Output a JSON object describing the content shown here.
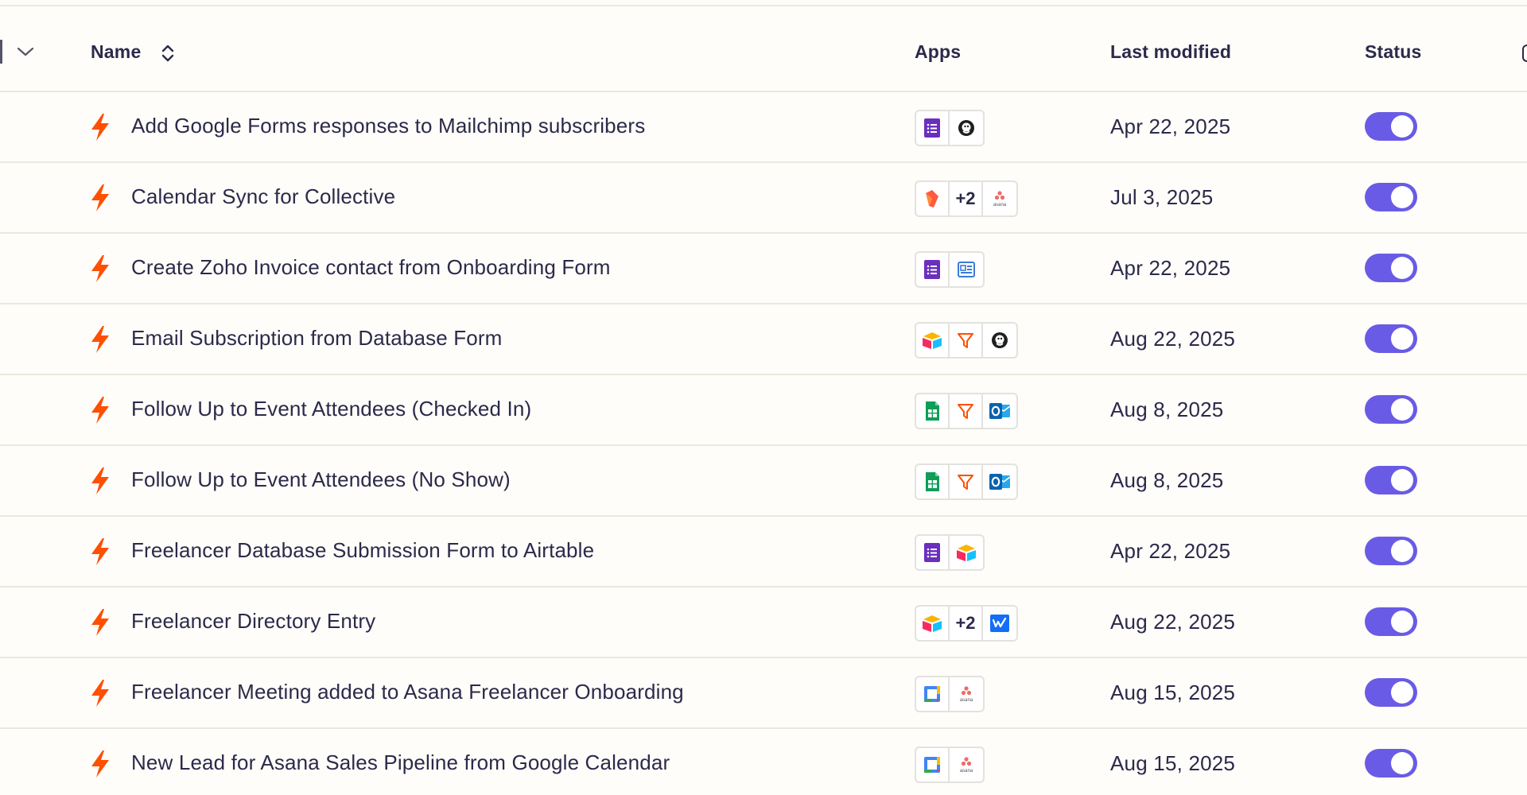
{
  "header": {
    "name_label": "Name",
    "apps_label": "Apps",
    "modified_label": "Last modified",
    "status_label": "Status"
  },
  "colors": {
    "bolt": "#ff4f00",
    "toggle_on": "#695be6",
    "row_divider": "#ebe9df",
    "background": "#fffdf9"
  },
  "zaps": [
    {
      "name": "Add Google Forms responses to Mailchimp subscribers",
      "apps": [
        "google-forms-icon",
        "mailchimp-icon"
      ],
      "more": "",
      "modified": "Apr 22, 2025",
      "status_on": true
    },
    {
      "name": "Calendar Sync for Collective",
      "apps": [
        "collective-icon",
        "asana-icon"
      ],
      "more": "+2",
      "modified": "Jul 3, 2025",
      "status_on": true
    },
    {
      "name": "Create Zoho Invoice contact from Onboarding Form",
      "apps": [
        "google-forms-icon",
        "zoho-invoice-icon"
      ],
      "more": "",
      "modified": "Apr 22, 2025",
      "status_on": true
    },
    {
      "name": "Email Subscription from Database Form",
      "apps": [
        "airtable-icon",
        "filter-icon",
        "mailchimp-icon"
      ],
      "more": "",
      "modified": "Aug 22, 2025",
      "status_on": true
    },
    {
      "name": "Follow Up to Event Attendees (Checked In)",
      "apps": [
        "google-sheets-icon",
        "filter-icon",
        "outlook-icon"
      ],
      "more": "",
      "modified": "Aug 8, 2025",
      "status_on": true
    },
    {
      "name": "Follow Up to Event Attendees (No Show)",
      "apps": [
        "google-sheets-icon",
        "filter-icon",
        "outlook-icon"
      ],
      "more": "",
      "modified": "Aug 8, 2025",
      "status_on": true
    },
    {
      "name": "Freelancer Database Submission Form to Airtable",
      "apps": [
        "google-forms-icon",
        "airtable-icon"
      ],
      "more": "",
      "modified": "Apr 22, 2025",
      "status_on": true
    },
    {
      "name": "Freelancer Directory Entry",
      "apps": [
        "airtable-icon",
        "webflow-icon"
      ],
      "more": "+2",
      "modified": "Aug 22, 2025",
      "status_on": true
    },
    {
      "name": "Freelancer Meeting added to Asana Freelancer Onboarding",
      "apps": [
        "google-calendar-icon",
        "asana-icon"
      ],
      "more": "",
      "modified": "Aug 15, 2025",
      "status_on": true
    },
    {
      "name": "New Lead for Asana Sales Pipeline from Google Calendar",
      "apps": [
        "google-calendar-icon",
        "asana-icon"
      ],
      "more": "",
      "modified": "Aug 15, 2025",
      "status_on": true
    }
  ]
}
